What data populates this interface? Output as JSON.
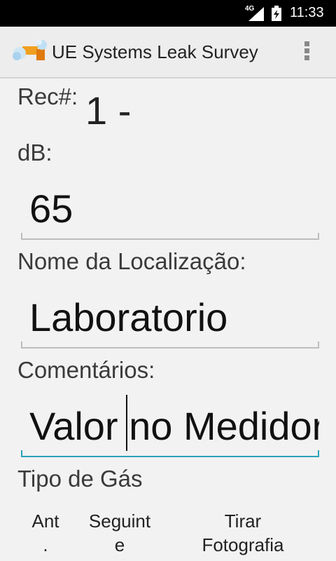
{
  "status_bar": {
    "network": "4G",
    "time": "11:33"
  },
  "action_bar": {
    "title": "UE Systems Leak Survey",
    "app_icon": "leak-survey-app-icon",
    "menu_icon": "overflow-menu-icon"
  },
  "form": {
    "rec_label": "Rec#:",
    "rec_value": "1 -",
    "db_label": "dB:",
    "db_value": "65",
    "location_label": "Nome da Localização:",
    "location_value": "Laboratorio",
    "comments_label": "Comentários:",
    "comments_value": "Valor no Medidor",
    "gas_type_label": "Tipo de Gás"
  },
  "buttons": {
    "previous_line1": "Ant",
    "previous_line2": ".",
    "next_line1": "Seguint",
    "next_line2": "e",
    "photo_line1": "Tirar",
    "photo_line2": "Fotografia"
  },
  "colors": {
    "focus_underline": "#2aa2b8",
    "status_bar": "#000000"
  }
}
